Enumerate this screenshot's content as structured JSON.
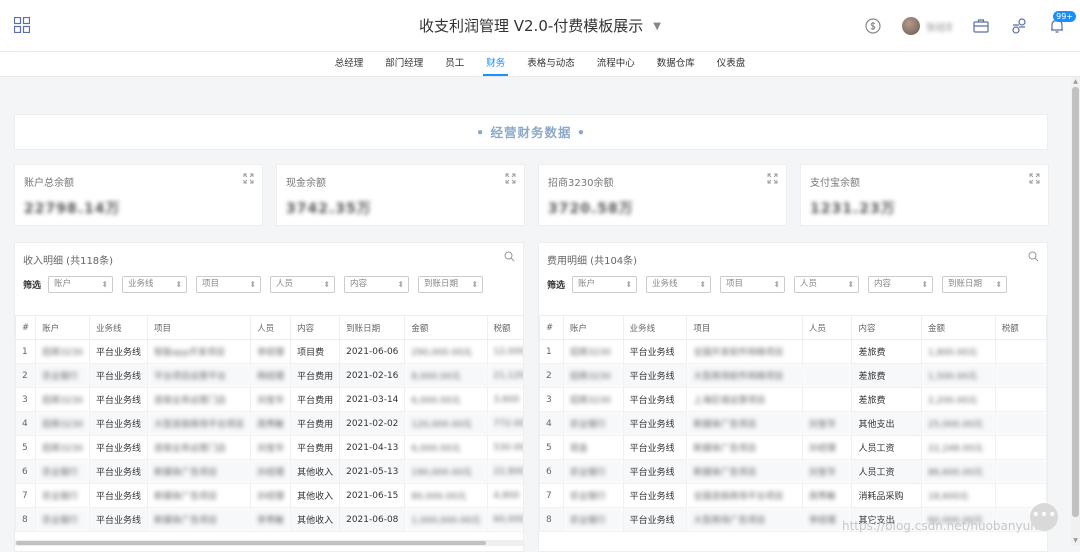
{
  "header": {
    "title": "收支利润管理 V2.0-付费模板展示",
    "user_name": "张经理",
    "badge": "99+",
    "icons": [
      "grid-icon",
      "dollar-circle-icon",
      "briefcase-icon",
      "share-icon",
      "bell-icon"
    ]
  },
  "nav": {
    "items": [
      "总经理",
      "部门经理",
      "员工",
      "财务",
      "表格与动态",
      "流程中心",
      "数据仓库",
      "仪表盘"
    ],
    "active": "财务"
  },
  "section": {
    "title": "• 经营财务数据 •"
  },
  "cards": [
    {
      "label": "账户总余额",
      "value": "22798.14万"
    },
    {
      "label": "现金余额",
      "value": "3742.35万"
    },
    {
      "label": "招商3230余额",
      "value": "3720.58万"
    },
    {
      "label": "支付宝余额",
      "value": "1231.23万"
    }
  ],
  "income": {
    "title": "收入明细 (共118条)",
    "filter_label": "筛选",
    "filters": [
      "账户",
      "业务线",
      "项目",
      "人员",
      "内容",
      "到账日期"
    ],
    "columns": [
      "#",
      "账户",
      "业务线",
      "项目",
      "人员",
      "内容",
      "到账日期",
      "金额",
      "税额"
    ],
    "rows": [
      [
        "1",
        "招商3230",
        "平台业务线",
        "智能app开发项目",
        "李经理",
        "项目费",
        "2021-06-06",
        "290,000.00元",
        "12,000"
      ],
      [
        "2",
        "农业银行",
        "平台业务线",
        "平台项目运营平台",
        "杨经理",
        "平台费用",
        "2021-02-16",
        "8,000.00元",
        "21,120"
      ],
      [
        "3",
        "招商3230",
        "平台业务线",
        "连锁业务运营门店",
        "刘宝华",
        "平台费用",
        "2021-03-14",
        "6,000.00元",
        "3,600"
      ],
      [
        "4",
        "招商3230",
        "平台业务线",
        "大型连锁商场平台项目",
        "周秀敏",
        "平台费用",
        "2021-02-02",
        "120,000.00元",
        "772.00"
      ],
      [
        "5",
        "招商3230",
        "平台业务线",
        "连锁业务运营门店",
        "刘宝华",
        "平台费用",
        "2021-04-13",
        "6,000.00元",
        "530.00"
      ],
      [
        "6",
        "农业银行",
        "平台业务线",
        "新媒体广告项目",
        "孙经理",
        "其他收入",
        "2021-05-13",
        "190,000.00元",
        "22,800"
      ],
      [
        "7",
        "农业银行",
        "平台业务线",
        "新媒体广告项目",
        "孙经理",
        "其他收入",
        "2021-06-15",
        "80,000.00元",
        "4,800"
      ],
      [
        "8",
        "农业银行",
        "平台业务线",
        "新媒体广告项目",
        "李秀敏",
        "其他收入",
        "2021-06-08",
        "1,000,000.00元",
        "60,000"
      ]
    ]
  },
  "expense": {
    "title": "费用明细 (共104条)",
    "filter_label": "筛选",
    "filters": [
      "账户",
      "业务线",
      "项目",
      "人员",
      "内容",
      "到账日期"
    ],
    "columns": [
      "#",
      "账户",
      "业务线",
      "项目",
      "人员",
      "内容",
      "金额",
      "税额"
    ],
    "rows": [
      [
        "1",
        "招商3230",
        "平台业务线",
        "全国开发软件网络项目",
        "",
        "差旅费",
        "1,800.00元",
        ""
      ],
      [
        "2",
        "招商3230",
        "平台业务线",
        "大型商场软件网络项目",
        "",
        "差旅费",
        "1,500.00元",
        ""
      ],
      [
        "3",
        "招商3230",
        "平台业务线",
        "上海区域运营项目",
        "",
        "差旅费",
        "2,200.00元",
        ""
      ],
      [
        "4",
        "农业银行",
        "平台业务线",
        "新媒体广告项目",
        "刘宝华",
        "其他支出",
        "25,000.00元",
        ""
      ],
      [
        "5",
        "现金",
        "平台业务线",
        "新媒体广告项目",
        "孙经理",
        "人员工资",
        "22,248.00元",
        ""
      ],
      [
        "6",
        "农业银行",
        "平台业务线",
        "新媒体广告项目",
        "刘宝华",
        "人员工资",
        "86,600.00元",
        ""
      ],
      [
        "7",
        "农业银行",
        "平台业务线",
        "全国连锁商场平台项目",
        "周秀敏",
        "消耗品采购",
        "18,600元",
        ""
      ],
      [
        "8",
        "农业银行",
        "平台业务线",
        "大型商场广告项目",
        "李经理",
        "其它支出",
        "60,000.00元",
        ""
      ]
    ]
  },
  "watermark": "https://blog.csdn.net/huobanyun",
  "fab_icon": "more-icon"
}
